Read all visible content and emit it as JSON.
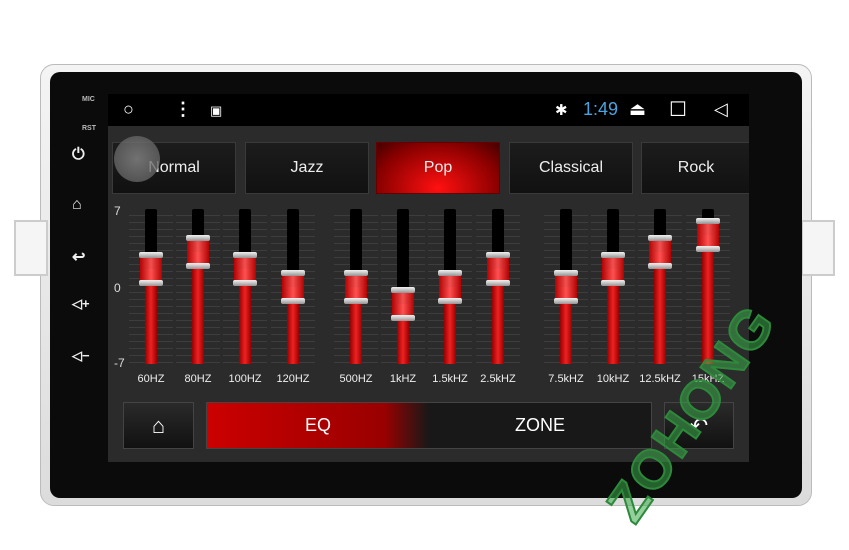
{
  "device": {
    "mic_label": "MIC",
    "rst_label": "RST",
    "watermark": "ZOHONG"
  },
  "status_bar": {
    "time": "1:49",
    "time_color": "#4aa3df",
    "icons": [
      "home-circle-icon",
      "menu-dots-icon",
      "gallery-icon",
      "bluetooth-icon",
      "eject-icon",
      "recents-square-icon",
      "back-triangle-icon"
    ]
  },
  "presets": [
    {
      "label": "Normal",
      "active": false
    },
    {
      "label": "Jazz",
      "active": false
    },
    {
      "label": "Pop",
      "active": true
    },
    {
      "label": "Classical",
      "active": false
    },
    {
      "label": "Rock",
      "active": false
    }
  ],
  "scale": {
    "max": "7",
    "mid": "0",
    "min": "-7"
  },
  "bands": [
    {
      "label": "60HZ",
      "value": 2
    },
    {
      "label": "80HZ",
      "value": 4
    },
    {
      "label": "100HZ",
      "value": 2
    },
    {
      "label": "120HZ",
      "value": 0
    },
    {
      "label": "500HZ",
      "value": 0
    },
    {
      "label": "1kHZ",
      "value": -2
    },
    {
      "label": "1.5kHZ",
      "value": 0
    },
    {
      "label": "2.5kHZ",
      "value": 2
    },
    {
      "label": "7.5kHZ",
      "value": 0
    },
    {
      "label": "10kHZ",
      "value": 2
    },
    {
      "label": "12.5kHZ",
      "value": 4
    },
    {
      "label": "15kHZ",
      "value": 6
    }
  ],
  "bottom": {
    "eq_label": "EQ",
    "zone_label": "ZONE",
    "active": "EQ"
  },
  "accent": "#e01010"
}
